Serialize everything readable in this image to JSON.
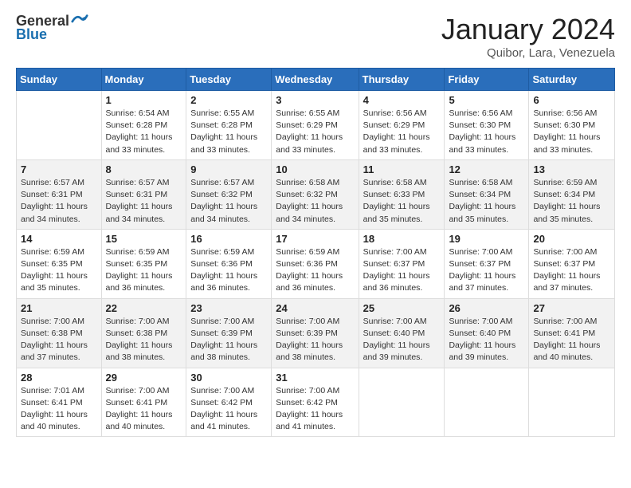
{
  "header": {
    "logo_general": "General",
    "logo_blue": "Blue",
    "month_title": "January 2024",
    "location": "Quibor, Lara, Venezuela"
  },
  "days_of_week": [
    "Sunday",
    "Monday",
    "Tuesday",
    "Wednesday",
    "Thursday",
    "Friday",
    "Saturday"
  ],
  "weeks": [
    [
      {
        "day": "",
        "info": ""
      },
      {
        "day": "1",
        "info": "Sunrise: 6:54 AM\nSunset: 6:28 PM\nDaylight: 11 hours\nand 33 minutes."
      },
      {
        "day": "2",
        "info": "Sunrise: 6:55 AM\nSunset: 6:28 PM\nDaylight: 11 hours\nand 33 minutes."
      },
      {
        "day": "3",
        "info": "Sunrise: 6:55 AM\nSunset: 6:29 PM\nDaylight: 11 hours\nand 33 minutes."
      },
      {
        "day": "4",
        "info": "Sunrise: 6:56 AM\nSunset: 6:29 PM\nDaylight: 11 hours\nand 33 minutes."
      },
      {
        "day": "5",
        "info": "Sunrise: 6:56 AM\nSunset: 6:30 PM\nDaylight: 11 hours\nand 33 minutes."
      },
      {
        "day": "6",
        "info": "Sunrise: 6:56 AM\nSunset: 6:30 PM\nDaylight: 11 hours\nand 33 minutes."
      }
    ],
    [
      {
        "day": "7",
        "info": "Sunrise: 6:57 AM\nSunset: 6:31 PM\nDaylight: 11 hours\nand 34 minutes."
      },
      {
        "day": "8",
        "info": "Sunrise: 6:57 AM\nSunset: 6:31 PM\nDaylight: 11 hours\nand 34 minutes."
      },
      {
        "day": "9",
        "info": "Sunrise: 6:57 AM\nSunset: 6:32 PM\nDaylight: 11 hours\nand 34 minutes."
      },
      {
        "day": "10",
        "info": "Sunrise: 6:58 AM\nSunset: 6:32 PM\nDaylight: 11 hours\nand 34 minutes."
      },
      {
        "day": "11",
        "info": "Sunrise: 6:58 AM\nSunset: 6:33 PM\nDaylight: 11 hours\nand 35 minutes."
      },
      {
        "day": "12",
        "info": "Sunrise: 6:58 AM\nSunset: 6:34 PM\nDaylight: 11 hours\nand 35 minutes."
      },
      {
        "day": "13",
        "info": "Sunrise: 6:59 AM\nSunset: 6:34 PM\nDaylight: 11 hours\nand 35 minutes."
      }
    ],
    [
      {
        "day": "14",
        "info": "Sunrise: 6:59 AM\nSunset: 6:35 PM\nDaylight: 11 hours\nand 35 minutes."
      },
      {
        "day": "15",
        "info": "Sunrise: 6:59 AM\nSunset: 6:35 PM\nDaylight: 11 hours\nand 36 minutes."
      },
      {
        "day": "16",
        "info": "Sunrise: 6:59 AM\nSunset: 6:36 PM\nDaylight: 11 hours\nand 36 minutes."
      },
      {
        "day": "17",
        "info": "Sunrise: 6:59 AM\nSunset: 6:36 PM\nDaylight: 11 hours\nand 36 minutes."
      },
      {
        "day": "18",
        "info": "Sunrise: 7:00 AM\nSunset: 6:37 PM\nDaylight: 11 hours\nand 36 minutes."
      },
      {
        "day": "19",
        "info": "Sunrise: 7:00 AM\nSunset: 6:37 PM\nDaylight: 11 hours\nand 37 minutes."
      },
      {
        "day": "20",
        "info": "Sunrise: 7:00 AM\nSunset: 6:37 PM\nDaylight: 11 hours\nand 37 minutes."
      }
    ],
    [
      {
        "day": "21",
        "info": "Sunrise: 7:00 AM\nSunset: 6:38 PM\nDaylight: 11 hours\nand 37 minutes."
      },
      {
        "day": "22",
        "info": "Sunrise: 7:00 AM\nSunset: 6:38 PM\nDaylight: 11 hours\nand 38 minutes."
      },
      {
        "day": "23",
        "info": "Sunrise: 7:00 AM\nSunset: 6:39 PM\nDaylight: 11 hours\nand 38 minutes."
      },
      {
        "day": "24",
        "info": "Sunrise: 7:00 AM\nSunset: 6:39 PM\nDaylight: 11 hours\nand 38 minutes."
      },
      {
        "day": "25",
        "info": "Sunrise: 7:00 AM\nSunset: 6:40 PM\nDaylight: 11 hours\nand 39 minutes."
      },
      {
        "day": "26",
        "info": "Sunrise: 7:00 AM\nSunset: 6:40 PM\nDaylight: 11 hours\nand 39 minutes."
      },
      {
        "day": "27",
        "info": "Sunrise: 7:00 AM\nSunset: 6:41 PM\nDaylight: 11 hours\nand 40 minutes."
      }
    ],
    [
      {
        "day": "28",
        "info": "Sunrise: 7:01 AM\nSunset: 6:41 PM\nDaylight: 11 hours\nand 40 minutes."
      },
      {
        "day": "29",
        "info": "Sunrise: 7:00 AM\nSunset: 6:41 PM\nDaylight: 11 hours\nand 40 minutes."
      },
      {
        "day": "30",
        "info": "Sunrise: 7:00 AM\nSunset: 6:42 PM\nDaylight: 11 hours\nand 41 minutes."
      },
      {
        "day": "31",
        "info": "Sunrise: 7:00 AM\nSunset: 6:42 PM\nDaylight: 11 hours\nand 41 minutes."
      },
      {
        "day": "",
        "info": ""
      },
      {
        "day": "",
        "info": ""
      },
      {
        "day": "",
        "info": ""
      }
    ]
  ]
}
